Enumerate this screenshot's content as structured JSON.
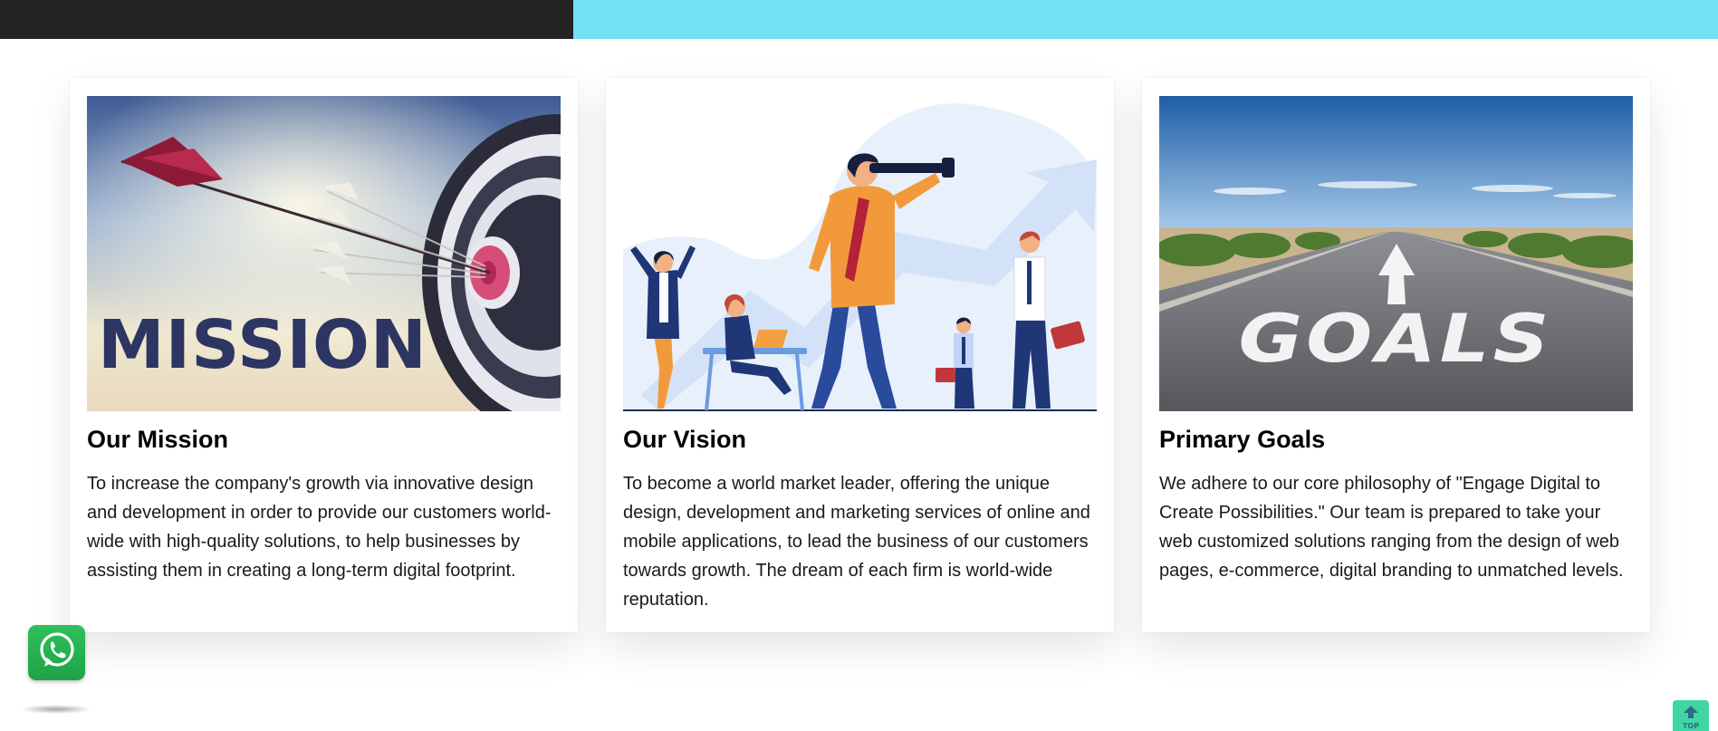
{
  "cards": [
    {
      "title": "Our Mission",
      "text": "To increase the company's growth via innovative design and development in order to provide our customers world-wide with high-quality solutions, to help businesses by assisting them in creating a long-term digital footprint.",
      "image_text": "MISSION"
    },
    {
      "title": "Our Vision",
      "text": "To become a world market leader, offering the unique design, development and marketing services of online and mobile applications, to lead the business of our customers towards growth. The dream of each firm is world-wide reputation."
    },
    {
      "title": "Primary Goals",
      "text": "We adhere to our core philosophy of \"Engage Digital to Create Possibilities.\" Our team is prepared to take your web customized solutions ranging from the design of web pages, e-commerce, digital branding to unmatched levels.",
      "image_text": "GOALS"
    }
  ],
  "floating": {
    "whatsapp_icon": "whatsapp-icon",
    "back_to_top_label": "TOP"
  },
  "colors": {
    "topbar_dark": "#242424",
    "topbar_accent": "#73e2f2",
    "whatsapp_green": "#25b34f",
    "back_to_top": "#3fd6a4"
  }
}
